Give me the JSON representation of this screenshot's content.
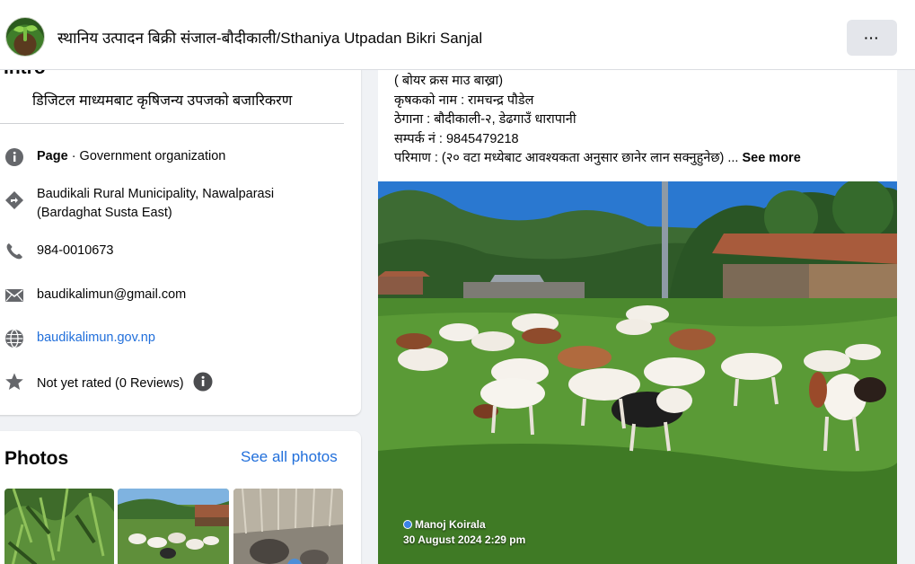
{
  "header": {
    "page_title": "स्थानिय उत्पादन बिक्री संजाल-बौदीकाली/Sthaniya Utpadan Bikri Sanjal",
    "more_label": "···"
  },
  "intro": {
    "heading": "Intro",
    "bio": "डिजिटल माध्यमबाट कृषिजन्य उपजको बजारिकरण",
    "page_type_bold": "Page",
    "page_type_rest": " · Government organization",
    "address_line1": "Baudikali Rural Municipality, Nawalparasi",
    "address_line2": "(Bardaghat Susta East)",
    "phone": "984-0010673",
    "email": "baudikalimun@gmail.com",
    "website": "baudikalimun.gov.np",
    "rating": "Not yet rated (0 Reviews)",
    "icons": [
      "info-icon",
      "location-icon",
      "phone-icon",
      "email-icon",
      "globe-icon",
      "star-icon",
      "info-icon"
    ]
  },
  "photos": {
    "heading": "Photos",
    "see_all": "See all photos"
  },
  "post": {
    "line1": "( बोयर क्रस माउ बाख्रा)",
    "line2": "कृषकको नाम : रामचन्द्र पौडेल",
    "line3": "ठेगाना : बौदीकाली-२, डेढगाउँ धारापानी",
    "line4": "सम्पर्क नं : 9845479218",
    "line5": "परिमाण : (२० वटा मध्येबाट आवश्यकता अनुसार छानेर लान सक्नुहुनेछ) ...",
    "see_more": "See more",
    "watermark_name": "Manoj Koirala",
    "watermark_date": "30 August 2024 2:29 pm"
  },
  "colors": {
    "accent_link": "#216fdb",
    "background": "#f0f2f5",
    "card": "#ffffff",
    "icon_gray": "#65676b"
  }
}
